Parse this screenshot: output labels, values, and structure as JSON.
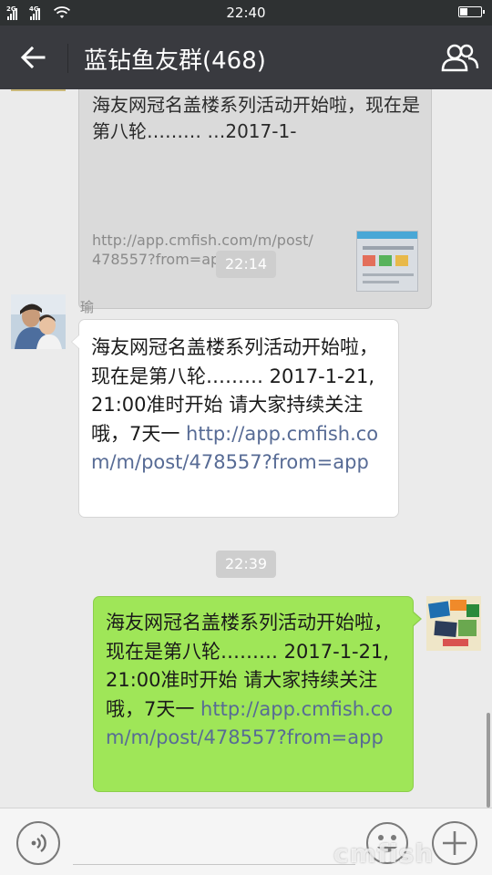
{
  "status_bar": {
    "network_1": "2G",
    "network_2": "4G",
    "time": "22:40",
    "battery_level": 0.35
  },
  "header": {
    "title": "蓝钻鱼友群(468)",
    "back_icon": "arrow-left-icon",
    "group_icon": "group-members-icon"
  },
  "messages": {
    "link_card": {
      "title": "海友网冠名盖楼系列活动开始啦，现在是第八轮……… …2017-1-",
      "url": "http://app.cmfish.com/m/post/478557?from=app"
    },
    "time_1": "22:14",
    "incoming": {
      "sender": "瑜",
      "text": "海友网冠名盖楼系列活动开始啦，现在是第八轮……… 2017-1-21, 21:00准时开始 请大家持续关注哦，7天一 ",
      "link": "http://app.cmfish.com/m/post/478557?from=app"
    },
    "time_2": "22:39",
    "outgoing": {
      "text": "海友网冠名盖楼系列活动开始啦，现在是第八轮……… 2017-1-21, 21:00准时开始 请大家持续关注哦，7天一 ",
      "link": "http://app.cmfish.com/m/post/478557?from=app"
    }
  },
  "input_bar": {
    "voice_icon": "voice-icon",
    "emoji_icon": "emoji-icon",
    "plus_icon": "plus-icon"
  },
  "watermark": "cmfish",
  "colors": {
    "title_bar": "#393a3f",
    "chat_bg": "#ebebeb",
    "outgoing_bubble": "#9fe658",
    "link": "#576b95"
  }
}
